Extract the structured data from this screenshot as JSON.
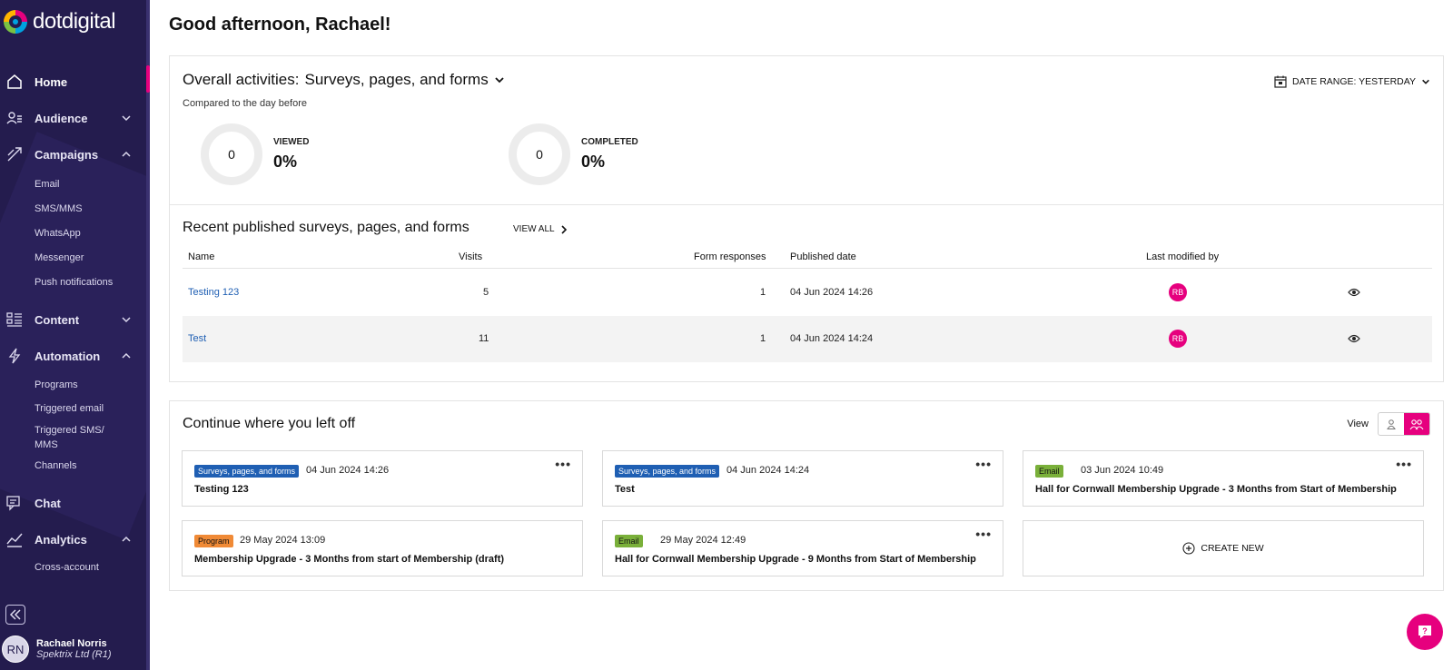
{
  "brand": {
    "name": "dotdigital",
    "accent": "#e6007e",
    "sidebar_bg": "#241c4e"
  },
  "sidebar": {
    "items": [
      {
        "label": "Home",
        "icon": "home-icon",
        "active": true
      },
      {
        "label": "Audience",
        "icon": "audience-icon",
        "expanded": false
      },
      {
        "label": "Campaigns",
        "icon": "campaigns-icon",
        "expanded": true,
        "children": [
          "Email",
          "SMS/MMS",
          "WhatsApp",
          "Messenger",
          "Push notifications"
        ]
      },
      {
        "label": "Content",
        "icon": "content-icon",
        "expanded": false
      },
      {
        "label": "Automation",
        "icon": "automation-icon",
        "expanded": true,
        "children": [
          "Programs",
          "Triggered email",
          "Triggered SMS/",
          "MMS",
          "Channels"
        ]
      },
      {
        "label": "Chat",
        "icon": "chat-icon"
      },
      {
        "label": "Analytics",
        "icon": "analytics-icon",
        "expanded": true,
        "children": [
          "Cross-account"
        ]
      }
    ],
    "user": {
      "initials": "RN",
      "name": "Rachael Norris",
      "org": "Spektrix Ltd (R1)"
    }
  },
  "greeting": "Good afternoon, Rachael!",
  "activities": {
    "title": "Overall activities:",
    "selector": "Surveys, pages, and forms",
    "compared": "Compared to the day before",
    "date_range": "DATE RANGE: YESTERDAY",
    "metrics": [
      {
        "count": "0",
        "label": "VIEWED",
        "percent": "0%"
      },
      {
        "count": "0",
        "label": "COMPLETED",
        "percent": "0%"
      }
    ]
  },
  "recent": {
    "title": "Recent published surveys, pages, and forms",
    "view_all": "VIEW ALL",
    "columns": [
      "Name",
      "Visits",
      "Form responses",
      "Published date",
      "Last modified by"
    ],
    "rows": [
      {
        "name": "Testing 123",
        "visits": "5",
        "responses": "1",
        "date": "04 Jun 2024 14:26",
        "modified_by": "RB"
      },
      {
        "name": "Test",
        "visits": "11",
        "responses": "1",
        "date": "04 Jun 2024 14:24",
        "modified_by": "RB"
      }
    ]
  },
  "continue": {
    "title": "Continue where you left off",
    "view_label": "View",
    "create_new": "CREATE NEW",
    "tiles": [
      {
        "tag": "Surveys, pages, and forms",
        "date": "04 Jun 2024 14:26",
        "name": "Testing 123"
      },
      {
        "tag": "Surveys, pages, and forms",
        "date": "04 Jun 2024 14:24",
        "name": "Test"
      },
      {
        "tag": "Email",
        "date": "03 Jun 2024 10:49",
        "name": "Hall for Cornwall Membership Upgrade - 3 Months from Start of Membership"
      },
      {
        "tag": "Program",
        "date": "29 May 2024 13:09",
        "name": "Membership Upgrade - 3 Months from start of Membership (draft)"
      },
      {
        "tag": "Email",
        "date": "29 May 2024 12:49",
        "name": "Hall for Cornwall Membership Upgrade - 9 Months from Start of Membership"
      }
    ]
  }
}
